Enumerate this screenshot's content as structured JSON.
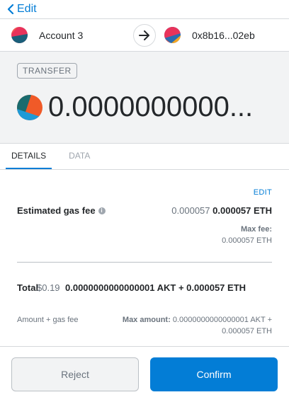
{
  "header": {
    "back_label": "Edit"
  },
  "accounts": {
    "from_name": "Account 3",
    "to_address": "0x8b16...02eb"
  },
  "hero": {
    "badge": "TRANSFER",
    "amount": "0.0000000000..."
  },
  "tabs": [
    {
      "label": "DETAILS",
      "active": true
    },
    {
      "label": "DATA",
      "active": false
    }
  ],
  "details": {
    "edit_label": "EDIT",
    "gas_label": "Estimated gas fee",
    "gas_secondary": "0.000057",
    "gas_primary": "0.000057 ETH",
    "max_fee_label": "Max fee:",
    "max_fee_value": "0.000057 ETH",
    "total_label": "Total",
    "total_fiat": "$0.19",
    "total_value": "0.0000000000000001 AKT + 0.000057 ETH",
    "amount_gas_label": "Amount + gas fee",
    "max_amount_label": "Max amount:",
    "max_amount_value": "0.0000000000000001 AKT + 0.000057 ETH"
  },
  "footer": {
    "reject_label": "Reject",
    "confirm_label": "Confirm"
  },
  "colors": {
    "accent": "#037dd6",
    "background_hero": "#f2f3f4"
  }
}
